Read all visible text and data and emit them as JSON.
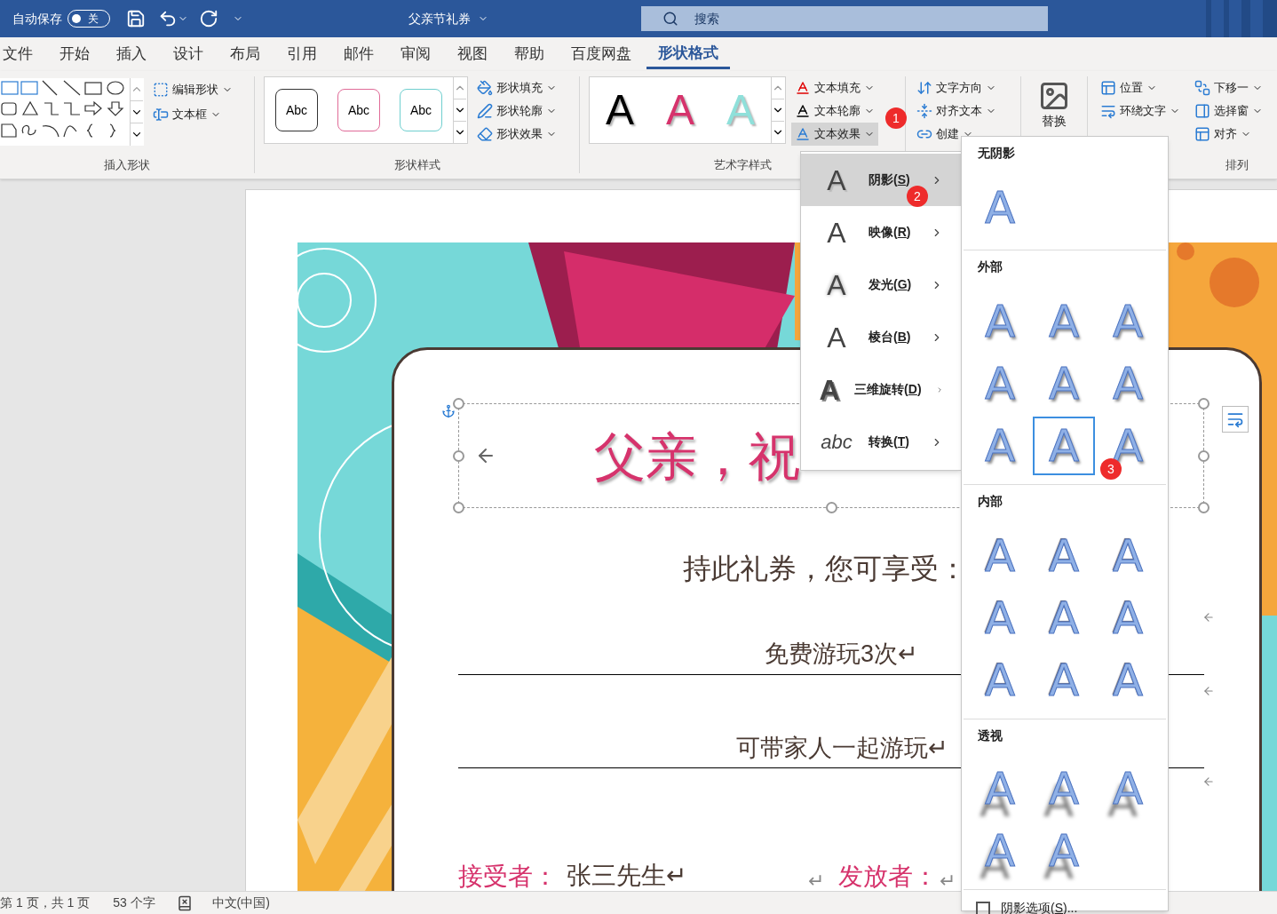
{
  "title_bar": {
    "autosave_label": "自动保存",
    "autosave_toggle": {
      "label": "关",
      "on": false
    },
    "document_title": "父亲节礼券",
    "search_placeholder": "搜索"
  },
  "tabs": [
    {
      "label": "文件",
      "selected": false
    },
    {
      "label": "开始",
      "selected": false
    },
    {
      "label": "插入",
      "selected": false
    },
    {
      "label": "设计",
      "selected": false
    },
    {
      "label": "布局",
      "selected": false
    },
    {
      "label": "引用",
      "selected": false
    },
    {
      "label": "邮件",
      "selected": false
    },
    {
      "label": "审阅",
      "selected": false
    },
    {
      "label": "视图",
      "selected": false
    },
    {
      "label": "帮助",
      "selected": false
    },
    {
      "label": "百度网盘",
      "selected": false
    },
    {
      "label": "形状格式",
      "selected": true
    }
  ],
  "ribbon": {
    "insert_shapes": {
      "commands": [
        {
          "label": "编辑形状",
          "kind": "edit"
        },
        {
          "label": "文本框",
          "kind": "textbox"
        }
      ],
      "group_label": "插入形状"
    },
    "shape_styles": {
      "previews": [
        {
          "label": "Abc",
          "color": "#333333"
        },
        {
          "label": "Abc",
          "color": "#e06b98"
        },
        {
          "label": "Abc",
          "color": "#6fcfcf"
        }
      ],
      "commands": [
        {
          "label": "形状填充",
          "kind": "fill"
        },
        {
          "label": "形状轮廓",
          "kind": "outline"
        },
        {
          "label": "形状效果",
          "kind": "effect"
        }
      ],
      "group_label": "形状样式"
    },
    "wordart_styles": {
      "previews": [
        {
          "label": "A",
          "color": "#000000"
        },
        {
          "label": "A",
          "color": "#d6336c"
        },
        {
          "label": "A",
          "color": "#8fe0da"
        }
      ],
      "commands": [
        {
          "label": "文本填充",
          "kind": "fill",
          "selected": false
        },
        {
          "label": "文本轮廓",
          "kind": "outline",
          "selected": false
        },
        {
          "label": "文本效果",
          "kind": "effect",
          "selected": true
        }
      ],
      "group_label": "艺术字样式"
    },
    "text": {
      "commands": [
        {
          "label": "文字方向",
          "kind": "direction"
        },
        {
          "label": "对齐文本",
          "kind": "align"
        },
        {
          "label": "创建",
          "kind": "link"
        }
      ]
    },
    "replace": {
      "label": "替换"
    },
    "arrange": {
      "commands": [
        {
          "label": "位置",
          "kind": "position"
        },
        {
          "label": "环绕文字",
          "kind": "wrap"
        },
        {
          "label": "下移一",
          "kind": "back"
        },
        {
          "label": "选择窗",
          "kind": "pane"
        },
        {
          "label": "对齐",
          "kind": "align"
        }
      ],
      "group_label": "排列"
    }
  },
  "document": {
    "title": "父亲，祝",
    "lines": [
      "持此礼券，您可享受：",
      "免费游玩3次↵",
      "可带家人一起游玩↵"
    ],
    "recipient": {
      "label": "接受者：",
      "value": "张三先生↵",
      "mark": "↵"
    },
    "issuer": {
      "label": "发放者：",
      "mark": "↵"
    }
  },
  "effects_menu": [
    {
      "glyph": "A",
      "label": "阴影(S)",
      "kind": "shadow",
      "selected": true
    },
    {
      "glyph": "A",
      "label": "映像(R)",
      "kind": "reflection",
      "selected": false
    },
    {
      "glyph": "A",
      "label": "发光(G)",
      "kind": "glow",
      "selected": false
    },
    {
      "glyph": "A",
      "label": "棱台(B)",
      "kind": "bevel",
      "selected": false
    },
    {
      "glyph": "A",
      "label": "三维旋转(D)",
      "kind": "rotate",
      "selected": false
    },
    {
      "glyph": "abc",
      "label": "转换(T)",
      "kind": "transform",
      "selected": false
    }
  ],
  "shadow_gallery": {
    "sections": [
      {
        "title": "无阴影",
        "kind": "none",
        "items": [
          {
            "label": "A",
            "selected": false
          }
        ]
      },
      {
        "title": "外部",
        "kind": "outer",
        "items": [
          {
            "label": "A",
            "selected": false
          },
          {
            "label": "A",
            "selected": false
          },
          {
            "label": "A",
            "selected": false
          },
          {
            "label": "A",
            "selected": false
          },
          {
            "label": "A",
            "selected": false
          },
          {
            "label": "A",
            "selected": false
          },
          {
            "label": "A",
            "selected": false
          },
          {
            "label": "A",
            "selected": true
          },
          {
            "label": "A",
            "selected": false
          }
        ]
      },
      {
        "title": "内部",
        "kind": "inner",
        "items": [
          {
            "label": "A",
            "selected": false
          },
          {
            "label": "A",
            "selected": false
          },
          {
            "label": "A",
            "selected": false
          },
          {
            "label": "A",
            "selected": false
          },
          {
            "label": "A",
            "selected": false
          },
          {
            "label": "A",
            "selected": false
          },
          {
            "label": "A",
            "selected": false
          },
          {
            "label": "A",
            "selected": false
          },
          {
            "label": "A",
            "selected": false
          }
        ]
      },
      {
        "title": "透视",
        "kind": "perspective",
        "items": [
          {
            "label": "A",
            "selected": false
          },
          {
            "label": "A",
            "selected": false
          },
          {
            "label": "A",
            "selected": false
          },
          {
            "label": "A",
            "selected": false
          },
          {
            "label": "A",
            "selected": false
          }
        ]
      }
    ],
    "options": {
      "label": "阴影选项(S)...",
      "checked": false
    }
  },
  "annotations": [
    {
      "label": "1"
    },
    {
      "label": "2"
    },
    {
      "label": "3"
    }
  ],
  "status_bar": {
    "page": "第 1 页，共 1 页",
    "words": "53 个字",
    "language": "中文(中国)"
  }
}
